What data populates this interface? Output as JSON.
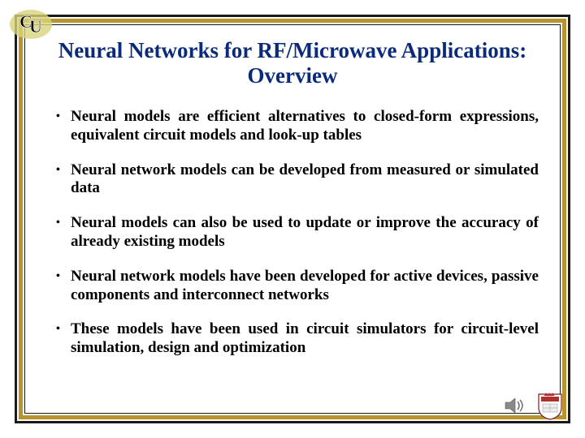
{
  "title": "Neural Networks for RF/Microwave Applications: Overview",
  "bullets": [
    "Neural models are efficient alternatives to closed-form expressions, equivalent circuit models and look-up tables",
    "Neural network models can be developed from measured or simulated data",
    "Neural models can also be used to update or improve the accuracy of already existing models",
    "Neural network models have been developed for active devices, passive components and interconnect networks",
    "These models have been used in circuit simulators for circuit-level simulation, design and optimization"
  ],
  "icons": {
    "logo_top_left": "CU interlocking logo",
    "logo_bottom_right": "shield/crest logo",
    "sound": "speaker icon"
  },
  "colors": {
    "title": "#0a2a7a",
    "gold": "#b8942e",
    "frame": "#1a1a1a"
  }
}
